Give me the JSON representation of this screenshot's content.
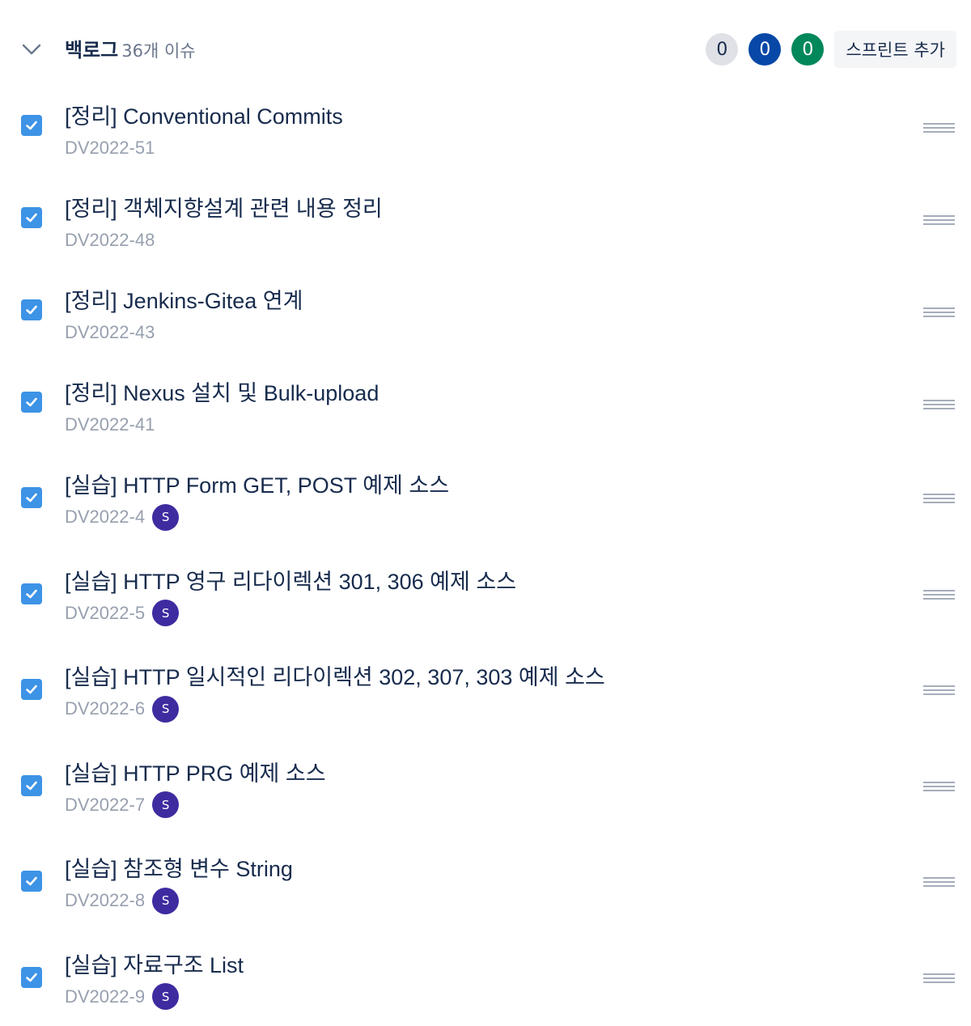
{
  "backlog": {
    "title": "백로그",
    "issue_count": "36개 이슈",
    "status_counts": {
      "todo": "0",
      "in_progress": "0",
      "done": "0"
    },
    "add_sprint_label": "스프린트 추가",
    "colors": {
      "todo_badge": "#dfe1e6",
      "in_progress_badge": "#0747a6",
      "done_badge": "#00875a",
      "checkbox": "#3d93e6",
      "avatar": "#3f2ba0"
    }
  },
  "issues": [
    {
      "summary": "[정리] Conventional Commits",
      "key": "DV2022-51",
      "checked": true
    },
    {
      "summary": "[정리] 객체지향설계 관련 내용 정리",
      "key": "DV2022-48",
      "checked": true
    },
    {
      "summary": "[정리] Jenkins-Gitea 연계",
      "key": "DV2022-43",
      "checked": true
    },
    {
      "summary": "[정리] Nexus 설치 및 Bulk-upload",
      "key": "DV2022-41",
      "checked": true
    },
    {
      "summary": "[실습] HTTP Form GET, POST 예제 소스",
      "key": "DV2022-4",
      "assignee": "S",
      "checked": true
    },
    {
      "summary": "[실습] HTTP 영구 리다이렉션 301, 306 예제 소스",
      "key": "DV2022-5",
      "assignee": "S",
      "checked": true
    },
    {
      "summary": "[실습] HTTP 일시적인 리다이렉션 302, 307, 303 예제 소스",
      "key": "DV2022-6",
      "assignee": "S",
      "checked": true
    },
    {
      "summary": "[실습] HTTP PRG 예제 소스",
      "key": "DV2022-7",
      "assignee": "S",
      "checked": true
    },
    {
      "summary": "[실습] 참조형 변수 String",
      "key": "DV2022-8",
      "assignee": "S",
      "checked": true
    },
    {
      "summary": "[실습] 자료구조 List",
      "key": "DV2022-9",
      "assignee": "S",
      "checked": true
    }
  ]
}
